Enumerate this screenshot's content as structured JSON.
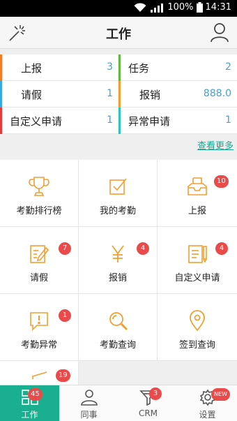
{
  "status_bar": {
    "battery": "100%",
    "time": "14:31"
  },
  "header": {
    "title": "工作"
  },
  "summary": [
    {
      "label": "上报",
      "value": "3",
      "color": "#f07d2a"
    },
    {
      "label": "任务",
      "value": "2",
      "color": "#66b844"
    },
    {
      "label": "请假",
      "value": "1",
      "color": "#3aa8e0"
    },
    {
      "label": "报销",
      "value": "888.0",
      "color": "#f0a032"
    },
    {
      "label": "自定义申请",
      "value": "1",
      "color": "#e33b3b"
    },
    {
      "label": "异常申请",
      "value": "1",
      "color": "#2cc7b5"
    }
  ],
  "more_link": "查看更多",
  "tiles": [
    {
      "label": "考勤排行榜",
      "icon": "trophy-icon"
    },
    {
      "label": "我的考勤",
      "icon": "checkbox-icon"
    },
    {
      "label": "上报",
      "icon": "inbox-icon",
      "badge": "10"
    },
    {
      "label": "请假",
      "icon": "edit-document-icon",
      "badge": "7"
    },
    {
      "label": "报销",
      "icon": "yen-icon",
      "badge": "4"
    },
    {
      "label": "自定义申请",
      "icon": "document-icon",
      "badge": "4"
    },
    {
      "label": "考勤异常",
      "icon": "alert-message-icon",
      "badge": "1"
    },
    {
      "label": "考勤查询",
      "icon": "search-icon"
    },
    {
      "label": "签到查询",
      "icon": "location-pin-icon"
    }
  ],
  "partial_tile_badge": "19",
  "tabs": [
    {
      "label": "工作",
      "icon": "grid-icon",
      "badge": "45",
      "active": true
    },
    {
      "label": "同事",
      "icon": "person-icon"
    },
    {
      "label": "CRM",
      "icon": "funnel-icon",
      "badge": "3"
    },
    {
      "label": "设置",
      "icon": "gear-icon",
      "badge": "NEW"
    }
  ],
  "colors": {
    "accent": "#1aaf8f",
    "icon_orange": "#f0a032",
    "badge_red": "#e94b4b",
    "value_blue": "#4a9fd0"
  }
}
